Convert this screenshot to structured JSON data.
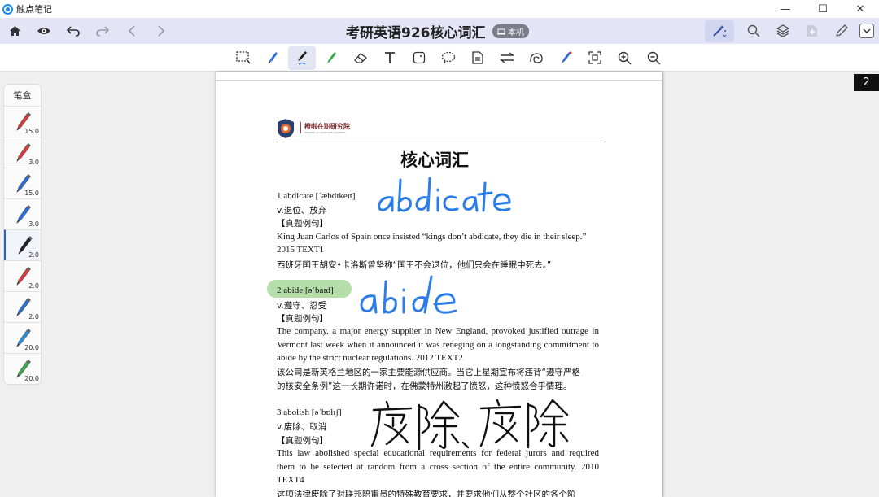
{
  "app": {
    "name": "触点笔记"
  },
  "window": {
    "minimize": "—",
    "maximize": "☐",
    "close": "✕"
  },
  "header": {
    "title": "考研英语926核心词汇",
    "badge": "本机"
  },
  "penbox": {
    "title": "笔盒",
    "pens": [
      {
        "size": "15.0",
        "color": "#d83a3a",
        "active": false
      },
      {
        "size": "3.0",
        "color": "#d83a3a",
        "active": false
      },
      {
        "size": "15.0",
        "color": "#2a6fd8",
        "active": false
      },
      {
        "size": "3.0",
        "color": "#2a6fd8",
        "active": false
      },
      {
        "size": "2.0",
        "color": "#222222",
        "active": true
      },
      {
        "size": "2.0",
        "color": "#d83a3a",
        "active": false
      },
      {
        "size": "2.0",
        "color": "#2a6fd8",
        "active": false
      },
      {
        "size": "20.0",
        "color": "#2a8ee0",
        "active": false
      },
      {
        "size": "20.0",
        "color": "#3aa84a",
        "active": false
      }
    ]
  },
  "page": {
    "number": "2",
    "institute": "橙啦在职研究院",
    "institute_sub": "ORANGE LA GRADUATE ACADEMY",
    "title": "核心词汇",
    "entries": {
      "e1_head": "1 abdicate   [ˈæbdɪkeɪt]",
      "e1_pos": "v.退位、放弃",
      "e1_label": "【真题例句】",
      "e1_example": "King Juan Carlos of Spain once insisted “kings don’t abdicate, they die in their sleep.”",
      "e1_source": "2015 TEXT1",
      "e1_zh": "西班牙国王胡安•卡洛斯曾坚称“国王不会退位，他们只会在睡眠中死去。”",
      "e2_head": "2 abide   [əˈbaɪd]",
      "e2_pos": "v.遵守、忍受",
      "e2_label": "【真题例句】",
      "e2_l1": "The company, a major energy supplier in New England, provoked justified outrage in",
      "e2_l2": "Vermont last week when it announced it was reneging on a longstanding commitment to",
      "e2_l3": "abide by the strict nuclear regulations.    2012 TEXT2",
      "e2_zh1": "该公司是新英格兰地区的一家主要能源供应商。当它上星期宣布将违背“遵守严格",
      "e2_zh2": "的核安全条例”这一长期许诺时，在佛蒙特州激起了愤怒，这种愤怒合乎情理。",
      "e3_head": "3 abolish   [əˈbɒlɪʃ]",
      "e3_pos": "v.废除、取消",
      "e3_label": "【真题例句】",
      "e3_l1": "This law abolished special educational requirements for federal jurors and required",
      "e3_l2": "them to be selected at random from a cross section of the entire community.    2010",
      "e3_l3": "TEXT4",
      "e3_zh1": "这项法律废除了对联邦陪审员的特殊教育要求，并要求他们从整个社区的各个阶"
    }
  },
  "colors": {
    "header_bg": "#e3e4f5",
    "ink_blue": "#2b7de9",
    "highlight": "#a8d89c"
  }
}
